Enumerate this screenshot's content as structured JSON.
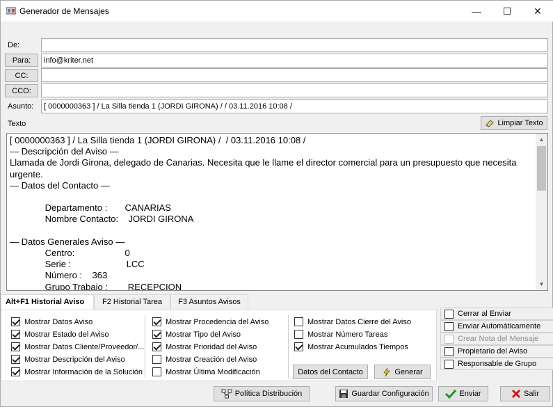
{
  "window": {
    "title": "Generador de Mensajes",
    "minimize": "—",
    "maximize": "☐",
    "close": "✕"
  },
  "header": {
    "de_label": "De:",
    "de_value": "",
    "para_label": "Para:",
    "para_value": "info@kriter.net",
    "cc_label": "CC:",
    "cc_value": "",
    "cco_label": "CCO:",
    "cco_value": "",
    "asunto_label": "Asunto:",
    "asunto_value": "[ 0000000363 ] / La Silla tienda 1 (JORDI GIRONA) /  / 03.11.2016 10:08 /"
  },
  "texto": {
    "label": "Texto",
    "clear_button": "Limpiar Texto",
    "body": "[ 0000000363 ] / La Silla tienda 1 (JORDI GIRONA) /  / 03.11.2016 10:08 /\n— Descripción del Aviso —\nLlamada de Jordi Girona, delegado de Canarias. Necesita que le llame el director comercial para un presupuesto que necesita urgente.\n— Datos del Contacto —\n\n              Departamento :       CANARIAS\n              Nombre Contacto:    JORDI GIRONA\n\n— Datos Generales Aviso —\n              Centro:                    0\n              Serie :                      LCC\n              Número :    363\n              Grupo Trabajo :        RECEPCION"
  },
  "tabs": [
    "Alt+F1 Historial Aviso",
    "F2 Historial Tarea",
    "F3 Asuntos Avisos"
  ],
  "options_col1": [
    {
      "label": "Mostrar Datos Aviso",
      "checked": true
    },
    {
      "label": "Mostrar Estado del Aviso",
      "checked": true
    },
    {
      "label": "Mostrar Datos Cliente/Proveedor/...",
      "checked": true
    },
    {
      "label": "Mostrar Descripción del Aviso",
      "checked": true
    },
    {
      "label": "Mostrar Información de la Solución",
      "checked": true
    }
  ],
  "options_col2": [
    {
      "label": "Mostrar Procedencia del Aviso",
      "checked": true
    },
    {
      "label": "Mostrar Tipo del Aviso",
      "checked": true
    },
    {
      "label": "Mostrar Prioridad del Aviso",
      "checked": true
    },
    {
      "label": "Mostrar Creación del Aviso",
      "checked": false
    },
    {
      "label": "Mostrar Última Modificación",
      "checked": false
    }
  ],
  "options_col3": [
    {
      "label": "Mostrar Datos Cierre del Aviso",
      "checked": false
    },
    {
      "label": "Mostrar Número Tareas",
      "checked": false
    },
    {
      "label": "Mostrar Acumulados Tiempos",
      "checked": true
    }
  ],
  "panel_buttons": {
    "contacto": "Datos del Contacto",
    "generar": "Generar"
  },
  "right_options": [
    {
      "label": "Cerrar al Enviar",
      "checked": false,
      "disabled": false
    },
    {
      "label": "Enviar Automáticamente",
      "checked": false,
      "disabled": false
    },
    {
      "label": "Crear Nota del Mensaje",
      "checked": false,
      "disabled": true
    },
    {
      "label": "Propietario del Aviso",
      "checked": false,
      "disabled": false
    },
    {
      "label": "Responsable de Grupo",
      "checked": false,
      "disabled": false
    }
  ],
  "footer": {
    "politica": "Política Distribución",
    "guardar": "Guardar Configuración",
    "enviar": "Enviar",
    "salir": "Salir"
  }
}
